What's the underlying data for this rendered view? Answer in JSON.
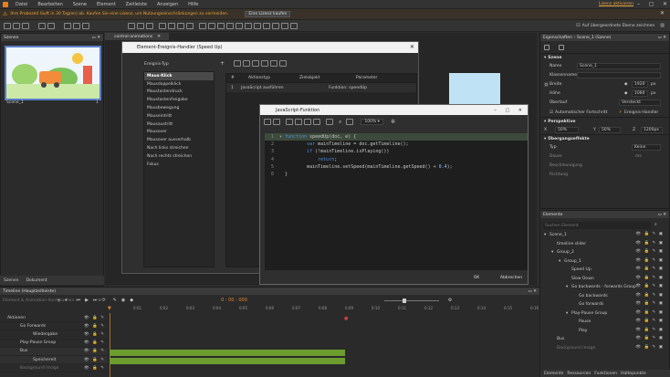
{
  "menu": {
    "items": [
      "Datei",
      "Bearbeiten",
      "Szene",
      "Element",
      "Zeitleiste",
      "Anzeigen",
      "Hilfe"
    ],
    "trial_link": "Lizenz aktivieren"
  },
  "banner": {
    "message": "Ihre Probezeit läuft in 30 Tag(en) ab. Kaufen Sie eine Lizenz, um Nutzungseinschränkungen zu vermeiden.",
    "buy": "Eine Lizenz kaufen"
  },
  "toolbar": {
    "overlay_checkbox": "Auf übergeordnete Ebene zeichnen"
  },
  "scenes": {
    "title": "Szenen",
    "scene_label": "Scene_1",
    "tabs": [
      "Szenen",
      "Dokument"
    ]
  },
  "document_tab": {
    "name": "control-animations"
  },
  "events_dialog": {
    "title": "Element-Ereignis-Handler (Speed Up)",
    "event_type_label": "Ereignis-Typ",
    "events": [
      "Maus-Klick",
      "Mausdoppelklick",
      "Maustastendruck",
      "Maustastenfreigabe",
      "Mausbewegung",
      "Mauseintritt",
      "Mausaustritt",
      "Mausover",
      "Mausover ausserhalb",
      "Nach links streichen",
      "Nach rechts streichen",
      "Fokus"
    ],
    "table_headers": [
      "#",
      "Aktionstyp",
      "Zielobjekt",
      "Parameter"
    ],
    "rows": [
      {
        "num": "1",
        "type": "JavaScript ausführen",
        "target": "",
        "param": "Funktion: speedUp"
      }
    ]
  },
  "js_dialog": {
    "title": "JavaScript-Funktion",
    "zoom": "100%",
    "code_lines": [
      {
        "n": "1",
        "segments": [
          {
            "t": "function",
            "c": "kw"
          },
          {
            "t": " speedUp(doc, e) {",
            "c": ""
          }
        ]
      },
      {
        "n": "2",
        "segments": [
          {
            "t": "        var",
            "c": "kw"
          },
          {
            "t": " mainTimeline = doc.getTimeline();",
            "c": ""
          }
        ]
      },
      {
        "n": "3",
        "segments": [
          {
            "t": "        if",
            "c": "kw"
          },
          {
            "t": " (!mainTimeline.isPlaying())",
            "c": ""
          }
        ]
      },
      {
        "n": "4",
        "segments": [
          {
            "t": "            return",
            "c": "kw"
          },
          {
            "t": ";",
            "c": ""
          }
        ]
      },
      {
        "n": "5",
        "segments": [
          {
            "t": "        mainTimeline.setSpeed(mainTimeline.getSpeed() + ",
            "c": ""
          },
          {
            "t": "0.4",
            "c": "num"
          },
          {
            "t": ");",
            "c": ""
          }
        ]
      },
      {
        "n": "6",
        "segments": [
          {
            "t": "}",
            "c": ""
          }
        ]
      }
    ],
    "ok": "OK",
    "cancel": "Abbrechen"
  },
  "properties": {
    "title": "Eigenschaften – Scene_1 (Szene)",
    "section_scene": "Szene",
    "name_label": "Name",
    "name_value": "Scene_1",
    "class_label": "Klassenname",
    "width_label": "Breite",
    "width_value": "1920",
    "width_unit": "px",
    "height_label": "Höhe",
    "height_value": "1080",
    "height_unit": "px",
    "overflow_label": "Überlauf",
    "overflow_value": "Versteckt",
    "autoplay_label": "Automatischer Fortschritt",
    "event_handler": "Ereignis-Handler",
    "section_perspective": "Perspektive",
    "px": "X",
    "px_value": "50%",
    "py": "Y",
    "py_value": "50%",
    "pz": "Z",
    "pz_value": "1200px",
    "section_transition": "Übergangseffekte",
    "type_label": "Typ",
    "type_value": "Keine",
    "duration_label": "Dauer",
    "duration_value": "ms",
    "accel_label": "Beschleunigung",
    "dir_label": "Richtung"
  },
  "elements": {
    "title": "Elemente",
    "search_placeholder": "Suchen Element",
    "tree": [
      {
        "label": "Scene_1",
        "level": 0,
        "dim": false
      },
      {
        "label": "timeline slider",
        "level": 1,
        "dim": false
      },
      {
        "label": "Group_2",
        "level": 1,
        "dim": false
      },
      {
        "label": "Group_1",
        "level": 2,
        "dim": false
      },
      {
        "label": "Speed Up",
        "level": 3,
        "dim": false
      },
      {
        "label": "Slow Down",
        "level": 3,
        "dim": false
      },
      {
        "label": "Go backwards - forwards Group",
        "level": 3,
        "dim": false
      },
      {
        "label": "Go backwards",
        "level": 4,
        "dim": false
      },
      {
        "label": "Go forwards",
        "level": 4,
        "dim": false
      },
      {
        "label": "Play-Pause Group",
        "level": 3,
        "dim": false
      },
      {
        "label": "Pause",
        "level": 4,
        "dim": false
      },
      {
        "label": "Play",
        "level": 4,
        "dim": false
      },
      {
        "label": "Bus",
        "level": 1,
        "dim": false
      },
      {
        "label": "Background Image",
        "level": 1,
        "dim": true
      }
    ],
    "tabs": [
      "Elemente",
      "Ressourcen",
      "Funktionen",
      "Haltepunkte"
    ]
  },
  "timeline": {
    "title": "Timeline (Hauptzeitleiste)",
    "search_placeholder": "Element & Animation durchsuchen",
    "time": "0 : 00 : 000",
    "ticks": [
      "0:01",
      "0:02",
      "0:03",
      "0:04",
      "0:05",
      "0:06",
      "0:07",
      "0:08",
      "0:09",
      "0:10",
      "0:11",
      "0:12",
      "0:13",
      "0:14",
      "0:15",
      "0:16"
    ],
    "tracks": [
      {
        "label": "Aktionen",
        "indent": 0
      },
      {
        "label": "Go Forwards",
        "indent": 0
      },
      {
        "label": "Wiedergabe",
        "indent": 1
      },
      {
        "label": "Play-Pause Group",
        "indent": 0
      },
      {
        "label": "Bus",
        "indent": 0
      },
      {
        "label": "Speichereit",
        "indent": 1
      },
      {
        "label": "Background Image",
        "indent": 0
      }
    ]
  }
}
